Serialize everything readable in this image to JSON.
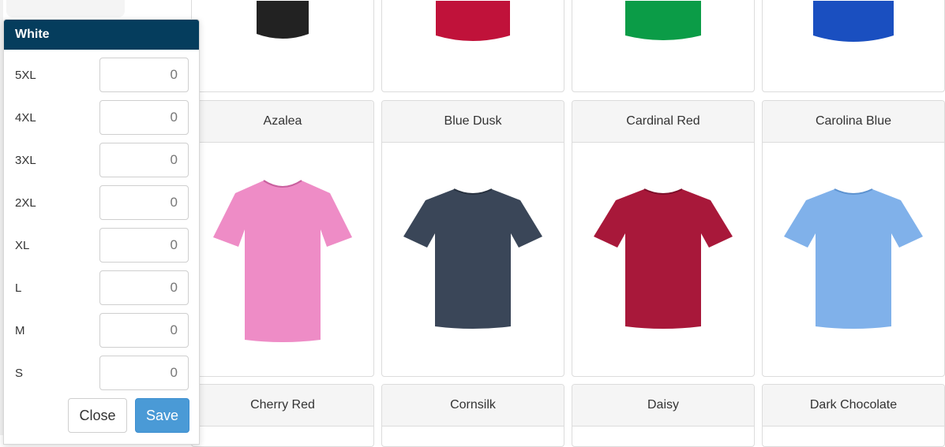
{
  "colors": {
    "header_bg": "#053d5d",
    "save_bg": "#4a9ad6",
    "card_head_bg": "#f5f5f5",
    "shirt_black": "#222222",
    "shirt_red": "#c0123a",
    "shirt_green": "#0b9c47",
    "shirt_royal": "#1a4fc0",
    "shirt_azalea": "#ee8cc6",
    "shirt_blue_dusk": "#3a4658",
    "shirt_cardinal": "#a8183a",
    "shirt_carolina": "#80b1ea"
  },
  "popup": {
    "title": "White",
    "sizes": [
      {
        "label": "5XL",
        "value": "0"
      },
      {
        "label": "4XL",
        "value": "0"
      },
      {
        "label": "3XL",
        "value": "0"
      },
      {
        "label": "2XL",
        "value": "0"
      },
      {
        "label": "XL",
        "value": "0"
      },
      {
        "label": "L",
        "value": "0"
      },
      {
        "label": "M",
        "value": "0"
      },
      {
        "label": "S",
        "value": "0"
      }
    ],
    "close_label": "Close",
    "save_label": "Save"
  },
  "grid": {
    "top_row_colors": [
      "black",
      "red",
      "green",
      "royal"
    ],
    "middle_row": [
      {
        "name": "Azalea",
        "color": "#ee8cc6"
      },
      {
        "name": "Blue Dusk",
        "color": "#3a4658"
      },
      {
        "name": "Cardinal Red",
        "color": "#a8183a"
      },
      {
        "name": "Carolina Blue",
        "color": "#80b1ea"
      }
    ],
    "bottom_row": [
      {
        "name": "Cherry Red"
      },
      {
        "name": "Cornsilk"
      },
      {
        "name": "Daisy"
      },
      {
        "name": "Dark Chocolate"
      }
    ]
  }
}
